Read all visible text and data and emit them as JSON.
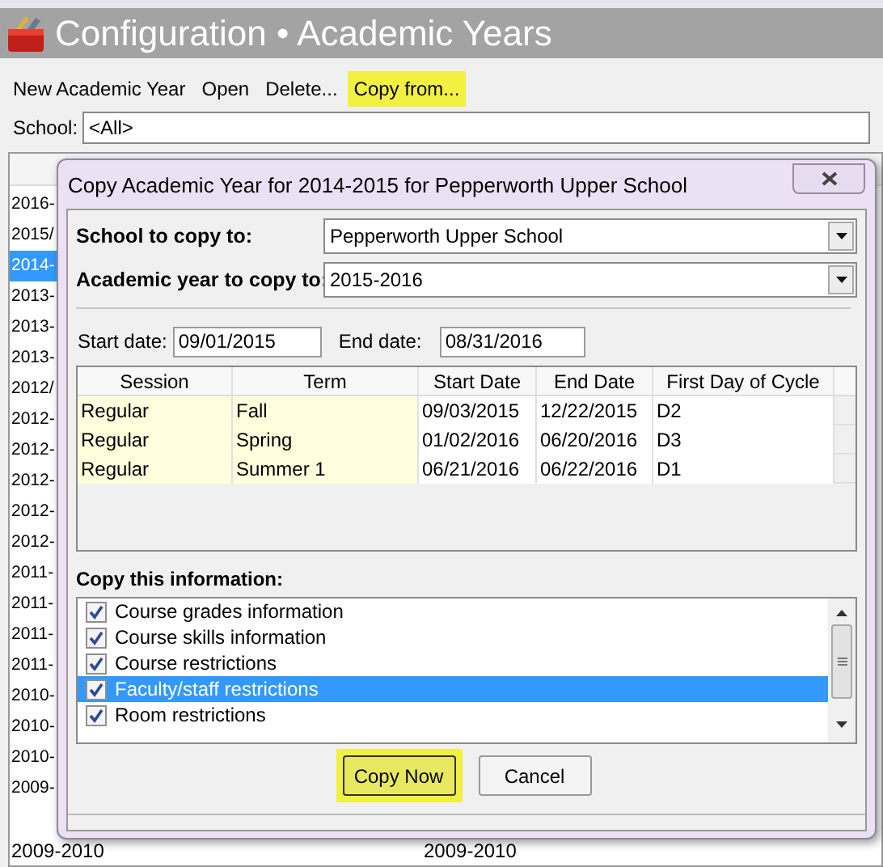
{
  "window": {
    "title": "Configuration • Academic Years"
  },
  "toolbar": [
    {
      "label": "New Academic Year",
      "highlighted": false
    },
    {
      "label": "Open",
      "highlighted": false
    },
    {
      "label": "Delete...",
      "highlighted": false
    },
    {
      "label": "Copy from...",
      "highlighted": true
    }
  ],
  "school_filter": {
    "label": "School:",
    "value": "<All>"
  },
  "years": [
    {
      "column_1": "2016-",
      "selected": false
    },
    {
      "column_1": "2015/",
      "selected": false
    },
    {
      "column_1": "2014-",
      "selected": true
    },
    {
      "column_1": "2013-",
      "selected": false
    },
    {
      "column_1": "2013-",
      "selected": false
    },
    {
      "column_1": "2013-",
      "selected": false
    },
    {
      "column_1": "2012/",
      "selected": false
    },
    {
      "column_1": "2012-",
      "selected": false
    },
    {
      "column_1": "2012-",
      "selected": false
    },
    {
      "column_1": "2012-",
      "selected": false
    },
    {
      "column_1": "2012-",
      "selected": false
    },
    {
      "column_1": "2012-",
      "selected": false
    },
    {
      "column_1": "2011-",
      "selected": false
    },
    {
      "column_1": "2011-",
      "selected": false
    },
    {
      "column_1": "2011-",
      "selected": false
    },
    {
      "column_1": "2011-",
      "selected": false
    },
    {
      "column_1": "2010-",
      "selected": false
    },
    {
      "column_1": "2010-",
      "selected": false
    },
    {
      "column_1": "2010-",
      "selected": false
    },
    {
      "column_1": "2009-",
      "selected": false
    },
    {
      "column_1": "2009-2010",
      "column_2": "2009-2010",
      "selected": false
    }
  ],
  "dialog": {
    "title": "Copy Academic Year for 2014-2015 for Pepperworth Upper School",
    "school_to": {
      "label": "School to copy to:",
      "value": "Pepperworth Upper School"
    },
    "year_to": {
      "label": "Academic year to copy to:",
      "value": "2015-2016"
    },
    "start_date": {
      "label": "Start date:",
      "value": "09/01/2015"
    },
    "end_date": {
      "label": "End date:",
      "value": "08/31/2016"
    },
    "table": {
      "columns": [
        "Session",
        "Term",
        "Start Date",
        "End Date",
        "First Day of Cycle"
      ],
      "rows": [
        [
          "Regular",
          "Fall",
          "09/03/2015",
          "12/22/2015",
          "D2"
        ],
        [
          "Regular",
          "Spring",
          "01/02/2016",
          "06/20/2016",
          "D3"
        ],
        [
          "Regular",
          "Summer 1",
          "06/21/2016",
          "06/22/2016",
          "D1"
        ]
      ]
    },
    "copy_label": "Copy this information:",
    "options": [
      {
        "label": "Course grades information",
        "checked": true,
        "selected": false
      },
      {
        "label": "Course skills information",
        "checked": true,
        "selected": false
      },
      {
        "label": "Course restrictions",
        "checked": true,
        "selected": false
      },
      {
        "label": "Faculty/staff restrictions",
        "checked": true,
        "selected": true
      },
      {
        "label": "Room restrictions",
        "checked": true,
        "selected": false
      }
    ],
    "buttons": [
      {
        "label": "Copy Now",
        "highlighted": true
      },
      {
        "label": "Cancel",
        "highlighted": false
      }
    ]
  }
}
